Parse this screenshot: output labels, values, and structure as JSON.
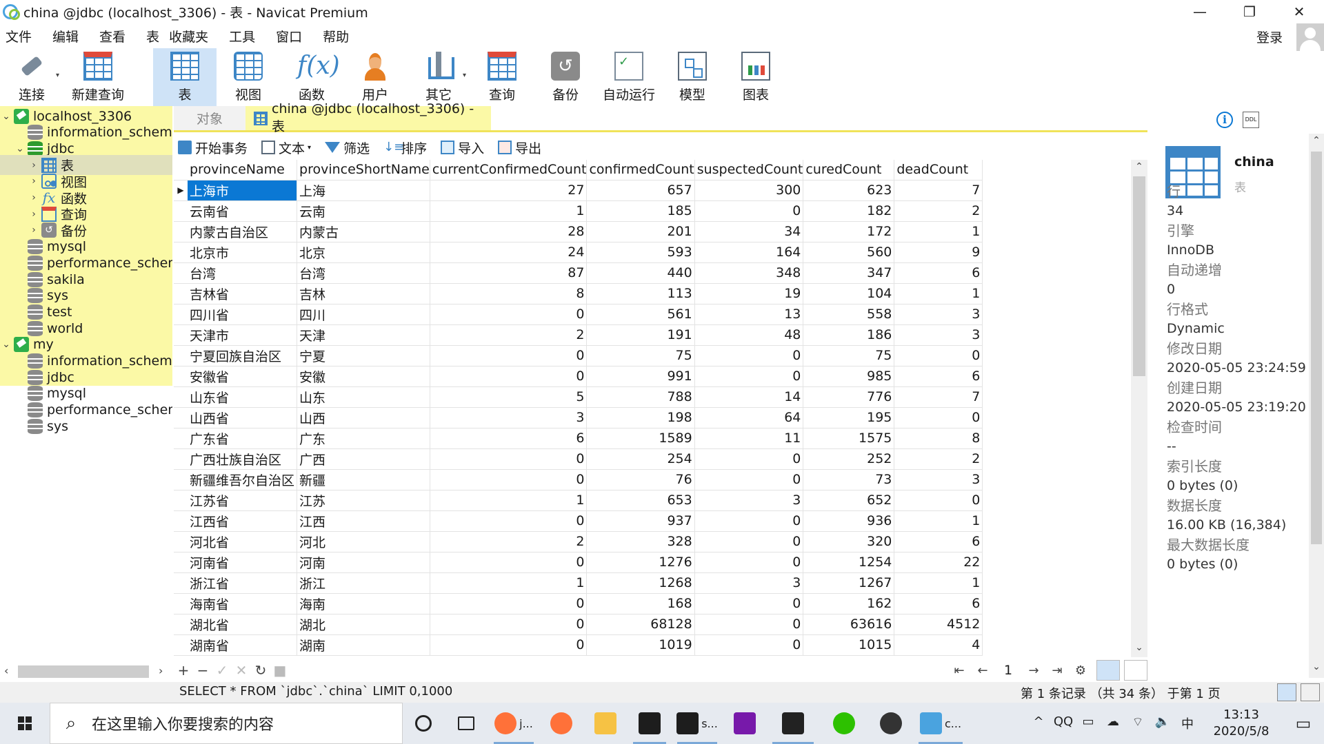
{
  "window": {
    "title": "china @jdbc (localhost_3306) - 表 - Navicat Premium",
    "minimize": "—",
    "maximize": "❐",
    "close": "✕"
  },
  "menu": [
    "文件",
    "编辑",
    "查看",
    "表",
    "收藏夹",
    "工具",
    "窗口",
    "帮助"
  ],
  "login_label": "登录",
  "toolbar": [
    {
      "label": "连接",
      "icon": "connection-icon",
      "dropdown": true
    },
    {
      "label": "新建查询",
      "icon": "new-query-icon",
      "dropdown": false
    },
    {
      "label": "表",
      "icon": "table-icon",
      "dropdown": false,
      "active": true
    },
    {
      "label": "视图",
      "icon": "view-icon",
      "dropdown": false
    },
    {
      "label": "函数",
      "icon": "function-icon",
      "dropdown": false
    },
    {
      "label": "用户",
      "icon": "user-icon",
      "dropdown": false
    },
    {
      "label": "其它",
      "icon": "tools-icon",
      "dropdown": true
    },
    {
      "label": "查询",
      "icon": "query-icon",
      "dropdown": false
    },
    {
      "label": "备份",
      "icon": "backup-icon",
      "dropdown": false
    },
    {
      "label": "自动运行",
      "icon": "automation-icon",
      "dropdown": false
    },
    {
      "label": "模型",
      "icon": "model-icon",
      "dropdown": false
    },
    {
      "label": "图表",
      "icon": "chart-icon",
      "dropdown": false
    }
  ],
  "tree": [
    {
      "label": "localhost_3306",
      "icon": "conn",
      "level": 0,
      "chev": "⌄"
    },
    {
      "label": "information_schema",
      "icon": "db",
      "level": 1,
      "chev": ""
    },
    {
      "label": "jdbc",
      "icon": "db green",
      "level": 1,
      "chev": "⌄"
    },
    {
      "label": "表",
      "icon": "tbl",
      "level": 2,
      "chev": "›",
      "selected": true
    },
    {
      "label": "视图",
      "icon": "view",
      "level": 2,
      "chev": "›"
    },
    {
      "label": "函数",
      "icon": "fx",
      "level": 2,
      "chev": "›"
    },
    {
      "label": "查询",
      "icon": "query",
      "level": 2,
      "chev": "›"
    },
    {
      "label": "备份",
      "icon": "backup",
      "level": 2,
      "chev": "›"
    },
    {
      "label": "mysql",
      "icon": "db",
      "level": 1,
      "chev": ""
    },
    {
      "label": "performance_schema",
      "icon": "db",
      "level": 1,
      "chev": ""
    },
    {
      "label": "sakila",
      "icon": "db",
      "level": 1,
      "chev": ""
    },
    {
      "label": "sys",
      "icon": "db",
      "level": 1,
      "chev": ""
    },
    {
      "label": "test",
      "icon": "db",
      "level": 1,
      "chev": ""
    },
    {
      "label": "world",
      "icon": "db",
      "level": 1,
      "chev": ""
    },
    {
      "label": "my",
      "icon": "conn",
      "level": 0,
      "chev": "⌄"
    },
    {
      "label": "information_schema",
      "icon": "db",
      "level": 1,
      "chev": ""
    },
    {
      "label": "jdbc",
      "icon": "db",
      "level": 1,
      "chev": ""
    },
    {
      "label": "mysql",
      "icon": "db",
      "level": 1,
      "chev": ""
    },
    {
      "label": "performance_schema",
      "icon": "db",
      "level": 1,
      "chev": ""
    },
    {
      "label": "sys",
      "icon": "db",
      "level": 1,
      "chev": ""
    }
  ],
  "tabs": {
    "objects": "对象",
    "active": "china @jdbc (localhost_3306) - 表"
  },
  "subtoolbar": {
    "begin_tx": "开始事务",
    "text": "文本",
    "filter": "筛选",
    "sort": "排序",
    "import": "导入",
    "export": "导出"
  },
  "grid": {
    "columns": [
      "provinceName",
      "provinceShortName",
      "currentConfirmedCount",
      "confirmedCount",
      "suspectedCount",
      "curedCount",
      "deadCount"
    ],
    "rows": [
      [
        "上海市",
        "上海",
        "27",
        "657",
        "300",
        "623",
        "7"
      ],
      [
        "云南省",
        "云南",
        "1",
        "185",
        "0",
        "182",
        "2"
      ],
      [
        "内蒙古自治区",
        "内蒙古",
        "28",
        "201",
        "34",
        "172",
        "1"
      ],
      [
        "北京市",
        "北京",
        "24",
        "593",
        "164",
        "560",
        "9"
      ],
      [
        "台湾",
        "台湾",
        "87",
        "440",
        "348",
        "347",
        "6"
      ],
      [
        "吉林省",
        "吉林",
        "8",
        "113",
        "19",
        "104",
        "1"
      ],
      [
        "四川省",
        "四川",
        "0",
        "561",
        "13",
        "558",
        "3"
      ],
      [
        "天津市",
        "天津",
        "2",
        "191",
        "48",
        "186",
        "3"
      ],
      [
        "宁夏回族自治区",
        "宁夏",
        "0",
        "75",
        "0",
        "75",
        "0"
      ],
      [
        "安徽省",
        "安徽",
        "0",
        "991",
        "0",
        "985",
        "6"
      ],
      [
        "山东省",
        "山东",
        "5",
        "788",
        "14",
        "776",
        "7"
      ],
      [
        "山西省",
        "山西",
        "3",
        "198",
        "64",
        "195",
        "0"
      ],
      [
        "广东省",
        "广东",
        "6",
        "1589",
        "11",
        "1575",
        "8"
      ],
      [
        "广西壮族自治区",
        "广西",
        "0",
        "254",
        "0",
        "252",
        "2"
      ],
      [
        "新疆维吾尔自治区",
        "新疆",
        "0",
        "76",
        "0",
        "73",
        "3"
      ],
      [
        "江苏省",
        "江苏",
        "1",
        "653",
        "3",
        "652",
        "0"
      ],
      [
        "江西省",
        "江西",
        "0",
        "937",
        "0",
        "936",
        "1"
      ],
      [
        "河北省",
        "河北",
        "2",
        "328",
        "0",
        "320",
        "6"
      ],
      [
        "河南省",
        "河南",
        "0",
        "1276",
        "0",
        "1254",
        "22"
      ],
      [
        "浙江省",
        "浙江",
        "1",
        "1268",
        "3",
        "1267",
        "1"
      ],
      [
        "海南省",
        "海南",
        "0",
        "168",
        "0",
        "162",
        "6"
      ],
      [
        "湖北省",
        "湖北",
        "0",
        "68128",
        "0",
        "63616",
        "4512"
      ],
      [
        "湖南省",
        "湖南",
        "0",
        "1019",
        "0",
        "1015",
        "4"
      ]
    ]
  },
  "pager": {
    "page": "1"
  },
  "info_panel": {
    "name": "china",
    "type": "表",
    "props": [
      {
        "k": "行",
        "v": "34"
      },
      {
        "k": "引擎",
        "v": "InnoDB"
      },
      {
        "k": "自动递增",
        "v": "0"
      },
      {
        "k": "行格式",
        "v": "Dynamic"
      },
      {
        "k": "修改日期",
        "v": "2020-05-05 23:24:59"
      },
      {
        "k": "创建日期",
        "v": "2020-05-05 23:19:20"
      },
      {
        "k": "检查时间",
        "v": "--"
      },
      {
        "k": "索引长度",
        "v": "0 bytes (0)"
      },
      {
        "k": "数据长度",
        "v": "16.00 KB (16,384)"
      },
      {
        "k": "最大数据长度",
        "v": "0 bytes (0)"
      }
    ]
  },
  "status": {
    "sql": "SELECT * FROM `jdbc`.`china` LIMIT 0,1000",
    "records": "第 1 条记录 （共 34 条） 于第 1 页"
  },
  "taskbar": {
    "search_placeholder": "在这里输入你要搜索的内容",
    "apps": [
      {
        "name": "cortana-icon",
        "label": "",
        "color": "#e6eaf0",
        "w": 60
      },
      {
        "name": "task-view-icon",
        "label": "",
        "color": "#e6eaf0",
        "w": 64
      },
      {
        "name": "firefox-icon",
        "label": "j...",
        "color": "#ff7139",
        "w": 74,
        "running": true
      },
      {
        "name": "firefox-icon-2",
        "label": "",
        "color": "#ff7139",
        "w": 64
      },
      {
        "name": "file-explorer-icon",
        "label": "",
        "color": "#f6c244",
        "w": 64
      },
      {
        "name": "intellij-icon",
        "label": "",
        "color": "#1d1d1d",
        "w": 64,
        "running": true
      },
      {
        "name": "intellij-icon-2",
        "label": "s...",
        "color": "#1d1d1d",
        "w": 74,
        "running": true
      },
      {
        "name": "onenote-icon",
        "label": "",
        "color": "#7719aa",
        "w": 64
      },
      {
        "name": "terminal-icon",
        "label": "",
        "color": "#222222",
        "w": 76,
        "running": true
      },
      {
        "name": "wechat-icon",
        "label": "",
        "color": "#2dc100",
        "w": 72
      },
      {
        "name": "photo-icon",
        "label": "",
        "color": "#333333",
        "w": 64
      },
      {
        "name": "navicat-icon",
        "label": "c...",
        "color": "#4aa3df",
        "w": 80,
        "running": true
      }
    ],
    "tray": [
      "^",
      "QQ",
      "▭",
      "☁",
      "⌔",
      "🔈",
      "中"
    ],
    "time": "13:13",
    "date": "2020/5/8"
  }
}
